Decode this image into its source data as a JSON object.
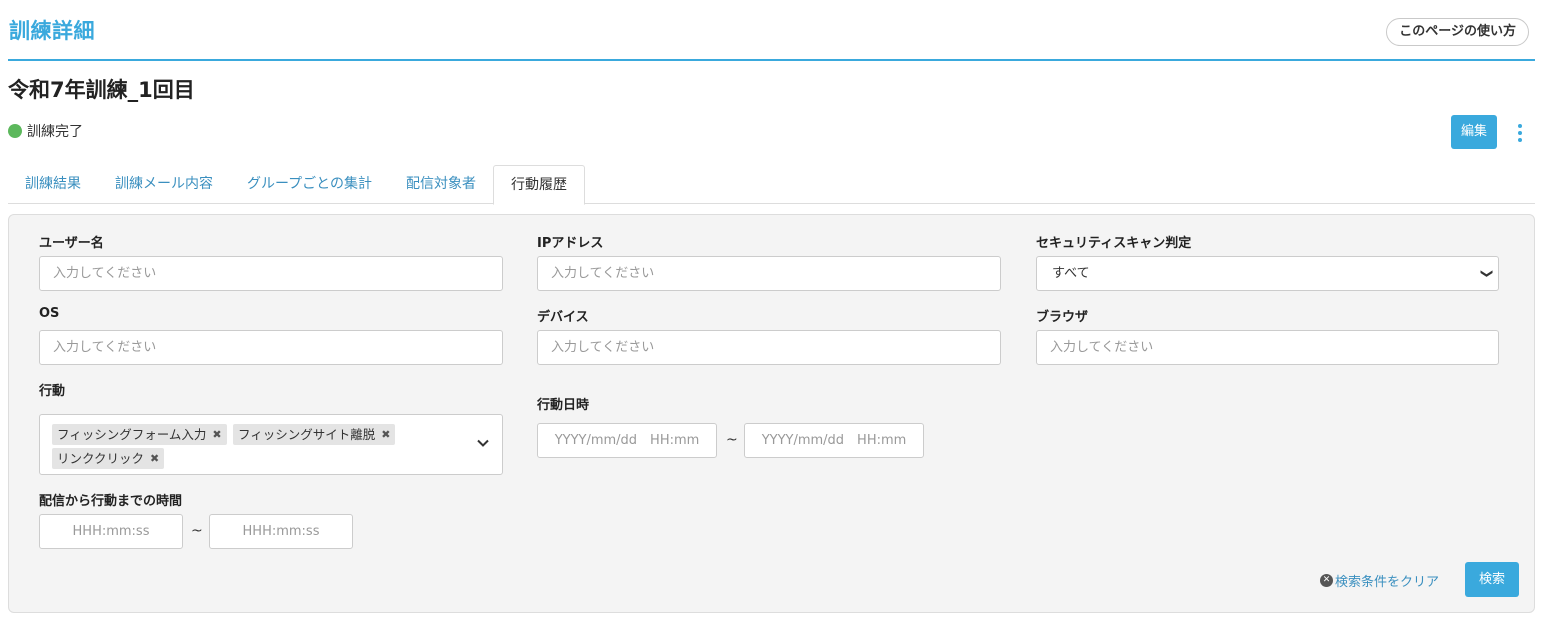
{
  "header": {
    "page_heading": "訓練詳細",
    "help_label": "このページの使い方"
  },
  "training": {
    "title": "令和7年訓練_1回目",
    "status": "訓練完了",
    "status_color": "#5cb85c",
    "edit_label": "編集"
  },
  "tabs": [
    {
      "label": "訓練結果",
      "active": false
    },
    {
      "label": "訓練メール内容",
      "active": false
    },
    {
      "label": "グループごとの集計",
      "active": false
    },
    {
      "label": "配信対象者",
      "active": false
    },
    {
      "label": "行動履歴",
      "active": true
    }
  ],
  "filters": {
    "username": {
      "label": "ユーザー名",
      "placeholder": "入力してください"
    },
    "ip": {
      "label": "IPアドレス",
      "placeholder": "入力してください"
    },
    "security_scan": {
      "label": "セキュリティスキャン判定",
      "value": "すべて"
    },
    "os": {
      "label": "OS",
      "placeholder": "入力してください"
    },
    "device": {
      "label": "デバイス",
      "placeholder": "入力してください"
    },
    "browser": {
      "label": "ブラウザ",
      "placeholder": "入力してください"
    },
    "action": {
      "label": "行動",
      "selected": [
        "フィッシングフォーム入力",
        "フィッシングサイト離脱",
        "リンククリック"
      ]
    },
    "action_datetime": {
      "label": "行動日時",
      "from_placeholder": "YYYY/mm/dd　HH:mm",
      "to_placeholder": "YYYY/mm/dd　HH:mm",
      "separator": "~"
    },
    "elapsed": {
      "label": "配信から行動までの時間",
      "from_placeholder": "HHH:mm:ss",
      "to_placeholder": "HHH:mm:ss",
      "separator": "~"
    }
  },
  "actions": {
    "clear_label": "検索条件をクリア",
    "search_label": "検索"
  },
  "colors": {
    "accent": "#3aa9dd",
    "link": "#3a8fbf",
    "panel_bg": "#f4f4f4"
  }
}
